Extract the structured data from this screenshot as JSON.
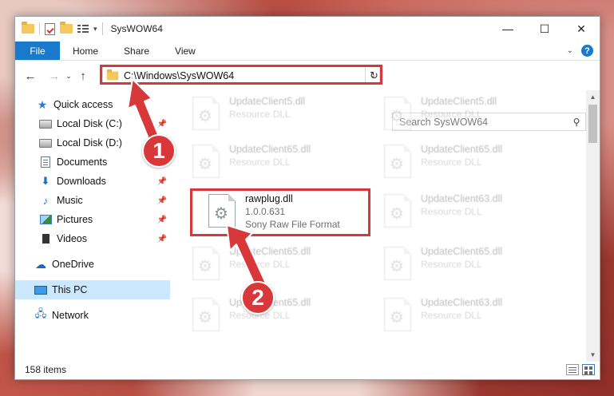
{
  "window": {
    "title": "SysWOW64",
    "minimize": "—",
    "maximize": "☐",
    "close": "✕"
  },
  "ribbon": {
    "tabs": [
      "File",
      "Home",
      "Share",
      "View"
    ]
  },
  "address": {
    "path": "C:\\Windows\\SysWOW64",
    "search_placeholder": "Search SysWOW64"
  },
  "nav": {
    "items": [
      {
        "label": "Quick access",
        "icon": "star-icon"
      },
      {
        "label": "Local Disk (C:)",
        "icon": "disk-icon",
        "pinned": true
      },
      {
        "label": "Local Disk (D:)",
        "icon": "disk-icon"
      },
      {
        "label": "Documents",
        "icon": "document-icon",
        "pinned": true
      },
      {
        "label": "Downloads",
        "icon": "download-icon",
        "pinned": true
      },
      {
        "label": "Music",
        "icon": "music-icon",
        "pinned": true
      },
      {
        "label": "Pictures",
        "icon": "pictures-icon",
        "pinned": true
      },
      {
        "label": "Videos",
        "icon": "videos-icon",
        "pinned": true
      },
      {
        "label": "OneDrive",
        "icon": "cloud-icon"
      },
      {
        "label": "This PC",
        "icon": "computer-icon",
        "selected": true
      },
      {
        "label": "Network",
        "icon": "network-icon"
      }
    ]
  },
  "files": [
    {
      "name": "UpdateClient5.dll",
      "desc": "Resource DLL"
    },
    {
      "name": "UpdateClient5.dll",
      "desc": "Resource DLL"
    },
    {
      "name": "UpdateClient65.dll",
      "desc": "Resource DLL"
    },
    {
      "name": "UpdateClient65.dll",
      "desc": "Resource DLL"
    },
    {
      "name": "rawplug.dll",
      "version": "1.0.0.631",
      "desc": "Sony Raw File Format"
    },
    {
      "name": "UpdateClient63.dll",
      "desc": "Resource DLL"
    },
    {
      "name": "UpdateClient65.dll",
      "desc": "Resource DLL"
    },
    {
      "name": "UpdateClient65.dll",
      "desc": "Resource DLL"
    },
    {
      "name": "UpdateClient65.dll",
      "desc": "Resource DLL"
    },
    {
      "name": "UpdateClient63.dll",
      "desc": "Resource DLL"
    }
  ],
  "status": {
    "item_count": "158 items"
  },
  "annotations": {
    "step1": "1",
    "step2": "2"
  },
  "colors": {
    "accent": "#1979ca",
    "highlight": "#d9383a",
    "selection": "#cce8ff"
  }
}
